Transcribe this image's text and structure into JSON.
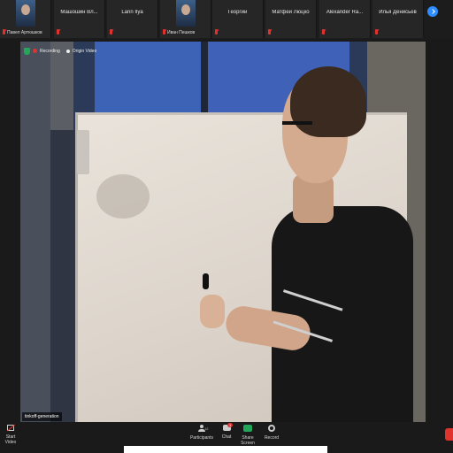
{
  "participants": [
    {
      "name": "",
      "caption": "Павел Артюшков",
      "photo": true
    },
    {
      "name": "Машошин Вл...",
      "caption": "",
      "photo": false
    },
    {
      "name": "Larin Ilya",
      "caption": "",
      "photo": false
    },
    {
      "name": "",
      "caption": "Иван Пешков",
      "photo": true
    },
    {
      "name": "Георгий",
      "caption": "",
      "photo": false
    },
    {
      "name": "Матфей Люцко",
      "caption": "",
      "photo": false
    },
    {
      "name": "Alexander Ra...",
      "caption": "",
      "photo": false
    },
    {
      "name": "Илья Денисьев",
      "caption": "",
      "photo": false
    }
  ],
  "stage": {
    "recording_label": "Recording",
    "origin_label": "Origin Video",
    "video_label": "tinkoff-generation"
  },
  "toolbar": {
    "start_video": "Start Video",
    "participants": "Participants",
    "participants_count": "12",
    "chat": "Chat",
    "chat_badge": "1",
    "share_screen": "Share Screen",
    "record": "Record"
  },
  "colors": {
    "accent": "#2d8cff",
    "alert": "#e0332e",
    "share": "#23a55a"
  },
  "icons": [
    "chevron-right-icon",
    "mic-muted-icon",
    "video-off-icon",
    "participants-icon",
    "chat-icon",
    "share-screen-icon",
    "record-icon",
    "recording-dot-icon",
    "shield-icon"
  ]
}
